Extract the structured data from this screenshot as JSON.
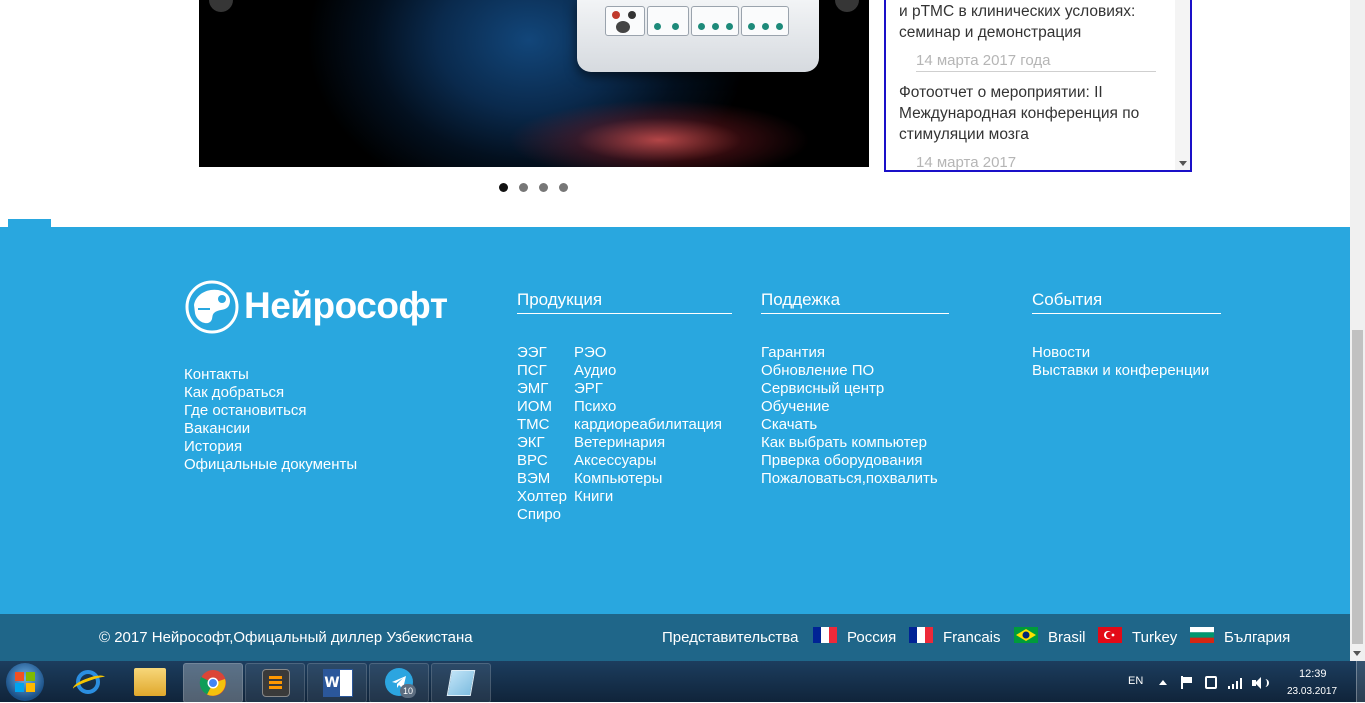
{
  "news": [
    {
      "title": "и рТМС в клинических условиях: семинар и демонстрация",
      "date": "14 марта 2017 года"
    },
    {
      "title": "Фотоотчет о мероприятии: II Международная конференция по стимуляции мозга",
      "date": "14 марта 2017"
    }
  ],
  "brand": {
    "name": "Нейрософт"
  },
  "company_links": [
    "Контакты",
    "Как добраться",
    "Где остановиться",
    "Вакансии",
    "История",
    "Офицальные документы"
  ],
  "products": {
    "heading": "Продукция",
    "col1": [
      "ЭЭГ",
      "ПСГ",
      "ЭМГ",
      "ИОМ",
      "ТМС",
      "ЭКГ",
      "ВРС",
      "ВЭМ",
      "Холтер",
      "Спиро"
    ],
    "col2": [
      "РЭО",
      "Аудио",
      "ЭРГ",
      "Психо",
      "кардиореабилитация",
      "Ветеринария",
      "Аксессуары",
      "Компьютеры",
      "Книги"
    ]
  },
  "support": {
    "heading": "Поддежка",
    "items": [
      "Гарантия",
      "Обновление ПО",
      "Сервисный центр",
      "Обучение",
      "Скачать",
      "Как выбрать компьютер",
      "Прверка оборудования",
      "Пожаловаться,похвалить"
    ]
  },
  "events": {
    "heading": "События",
    "items": [
      "Новости",
      "Выставки и конференции"
    ]
  },
  "bottom": {
    "copyright": "© 2017 Нейрософт,Офицальный диллер Узбекистана",
    "reps_label": "Представительства",
    "reps": [
      "Россия",
      "Francais",
      "Brasil",
      "Turkey",
      "България"
    ]
  },
  "taskbar": {
    "lang": "EN",
    "time": "12:39",
    "date": "23.03.2017",
    "telegram_badge": "10"
  }
}
